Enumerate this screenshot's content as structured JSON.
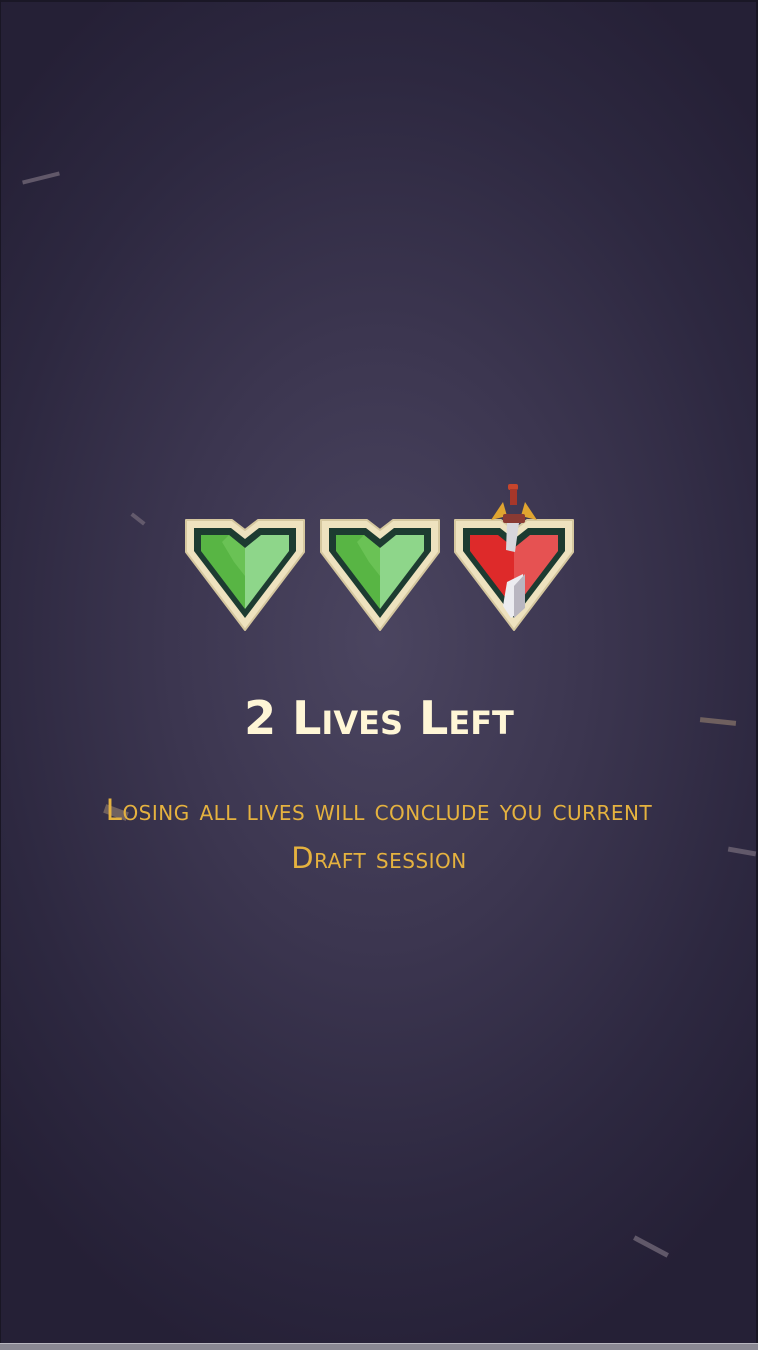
{
  "lives": {
    "remaining": 2,
    "total": 3,
    "slots": [
      {
        "state": "alive",
        "icon": "green-heart-icon"
      },
      {
        "state": "alive",
        "icon": "green-heart-icon"
      },
      {
        "state": "lost",
        "icon": "broken-heart-sword-icon"
      }
    ]
  },
  "message": {
    "title": "2 Lives Left",
    "subtitle": "Losing all lives will conclude you current Draft session"
  },
  "colors": {
    "background": "#3c3650",
    "title": "#fff6d6",
    "subtitle": "#e5b23f",
    "heart_alive": "#58b544",
    "heart_lost": "#de2a2a",
    "frame": "#eee2bf"
  }
}
